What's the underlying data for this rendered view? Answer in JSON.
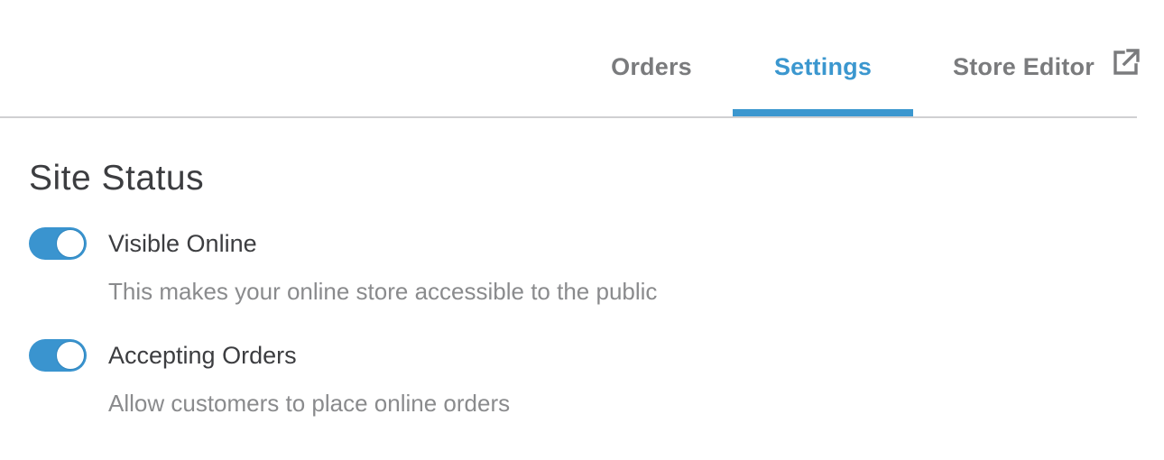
{
  "tabs": {
    "orders": "Orders",
    "settings": "Settings",
    "store_editor": "Store Editor",
    "active": "settings",
    "store_editor_icon": "external-link-icon"
  },
  "colors": {
    "accent": "#3b97cf",
    "tab_inactive": "#7a7b7d",
    "text": "#3c3d40",
    "muted_text": "#8a8b8d"
  },
  "site_status": {
    "title": "Site Status",
    "settings": [
      {
        "label": "Visible Online",
        "description": "This makes your online store accessible to the public",
        "enabled": true
      },
      {
        "label": "Accepting Orders",
        "description": "Allow customers to place online orders",
        "enabled": true
      }
    ]
  }
}
